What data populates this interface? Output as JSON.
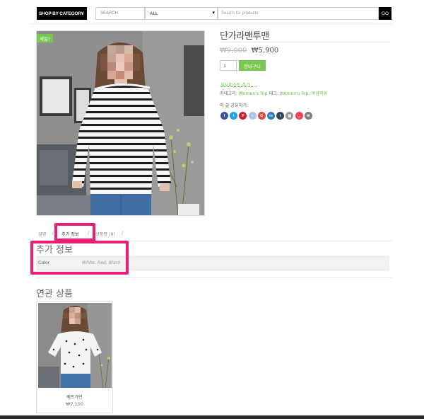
{
  "header": {
    "category_button": "SHOP BY CATEGORY",
    "search_label": "SEARCH",
    "category_select": "ALL",
    "search_placeholder": "Search for products",
    "go_label": "GO"
  },
  "product": {
    "sale_badge": "세일!",
    "title": "단가라맨투맨",
    "old_price": "₩9,000",
    "new_price": "₩5,900",
    "quantity": "1",
    "add_to_cart": "장바구니",
    "wishlist": "위시리스트 추가",
    "category_label": "카테고리:",
    "category_link": "Women's Top",
    "tags_label": "태그:",
    "tags_link": "Women's Top, 여성의류",
    "share_label": "이 글 공유하기:"
  },
  "share_icons": [
    {
      "name": "facebook-icon",
      "glyph": "f",
      "color": "#3b5998"
    },
    {
      "name": "twitter-icon",
      "glyph": "t",
      "color": "#1da1f2"
    },
    {
      "name": "pinterest-icon",
      "glyph": "P",
      "color": "#cb2027"
    },
    {
      "name": "reddit-icon",
      "glyph": "r",
      "color": "#aac4e8"
    },
    {
      "name": "google-plus-icon",
      "glyph": "G",
      "color": "#dd4b39"
    },
    {
      "name": "linkedin-icon",
      "glyph": "in",
      "color": "#2b7bb9"
    },
    {
      "name": "tumblr-icon",
      "glyph": "t",
      "color": "#35465c"
    },
    {
      "name": "print-icon",
      "glyph": "▤",
      "color": "#9a9a9a"
    },
    {
      "name": "pocket-icon",
      "glyph": "◡",
      "color": "#ef4056"
    },
    {
      "name": "email-icon",
      "glyph": "✉",
      "color": "#7f7f7f"
    }
  ],
  "tabs": [
    {
      "label": "설명"
    },
    {
      "label": "추가 정보"
    },
    {
      "label": "상품평 (0)"
    }
  ],
  "additional_info": {
    "title": "추가 정보",
    "attributes": [
      {
        "key": "Color",
        "value": "White, Red, Black"
      }
    ]
  },
  "related": {
    "title": "연관 상품",
    "items": [
      {
        "name": "배트가먼",
        "price": "₩7,100"
      }
    ]
  },
  "colors": {
    "accent": "#7ac74f",
    "highlight": "#e91e74"
  }
}
